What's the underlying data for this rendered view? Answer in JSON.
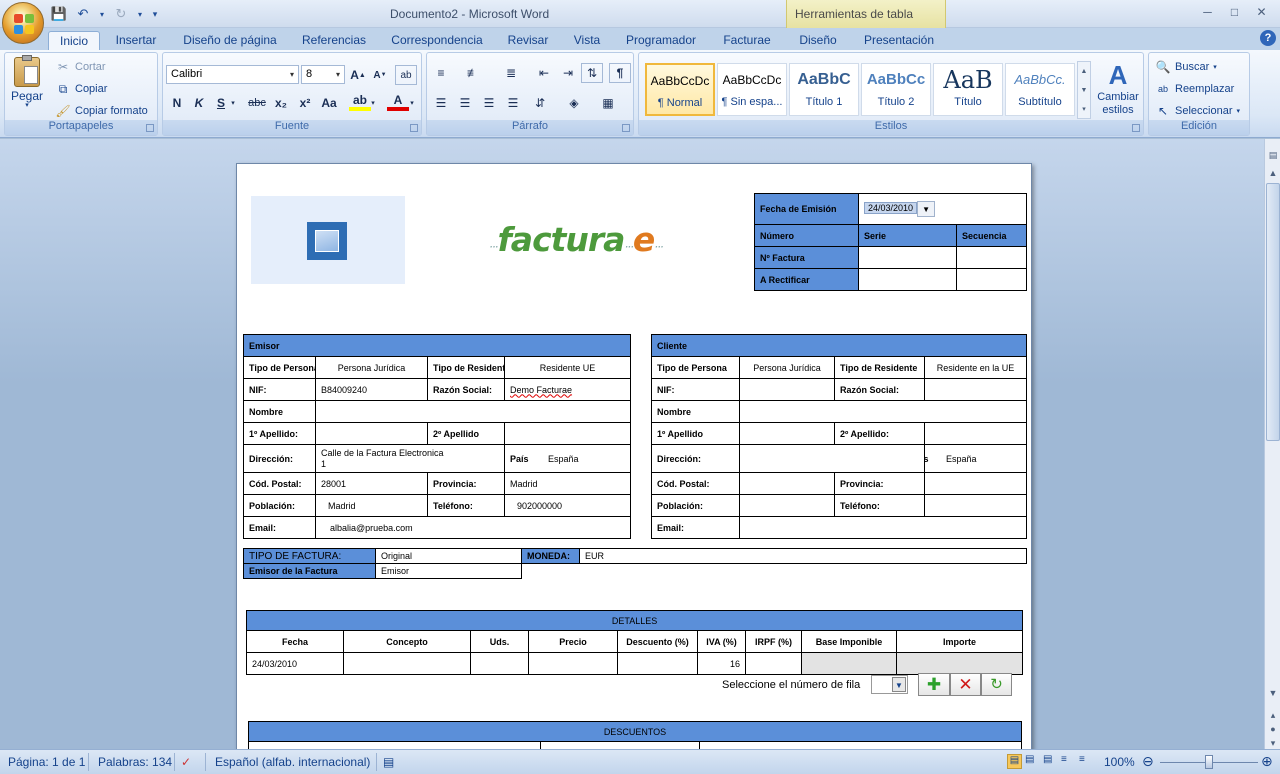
{
  "window": {
    "title": "Documento2 - Microsoft Word",
    "context_tab": "Herramientas de tabla"
  },
  "tabs": [
    "Inicio",
    "Insertar",
    "Diseño de página",
    "Referencias",
    "Correspondencia",
    "Revisar",
    "Vista",
    "Programador",
    "Facturae",
    "Diseño",
    "Presentación"
  ],
  "ribbon": {
    "clipboard": {
      "paste": "Pegar",
      "cut": "Cortar",
      "copy": "Copiar",
      "format_painter": "Copiar formato",
      "label": "Portapapeles"
    },
    "font": {
      "name": "Calibri",
      "size": "8",
      "label": "Fuente",
      "bold": "N",
      "italic": "K",
      "underline": "S",
      "strike": "abc",
      "sub": "x₂",
      "sup": "x²",
      "case": "Aa"
    },
    "paragraph": {
      "label": "Párrafo"
    },
    "styles": {
      "label": "Estilos",
      "change": "Cambiar estilos",
      "items": [
        {
          "sample": "AaBbCcDc",
          "name": "¶ Normal"
        },
        {
          "sample": "AaBbCcDc",
          "name": "¶ Sin espa..."
        },
        {
          "sample": "AaBbC",
          "name": "Título 1"
        },
        {
          "sample": "AaBbCc",
          "name": "Título 2"
        },
        {
          "sample": "AaB",
          "name": "Título"
        },
        {
          "sample": "AaBbCc.",
          "name": "Subtítulo"
        }
      ]
    },
    "editing": {
      "label": "Edición",
      "find": "Buscar",
      "replace": "Reemplazar",
      "select": "Seleccionar"
    }
  },
  "doc": {
    "brand": {
      "main": "factura",
      "e": "e"
    },
    "header_table": {
      "date_label": "Fecha de Emisión",
      "date_value": "24/03/2010",
      "numero": "Número",
      "serie": "Serie",
      "secuencia": "Secuencia",
      "n_factura": "Nº Factura",
      "a_rectificar": "A Rectificar"
    },
    "emisor": {
      "title": "Emisor",
      "tipo_persona_label": "Tipo de Persona",
      "tipo_persona": "Persona Jurídica",
      "tipo_residente_label": "Tipo de Residente",
      "tipo_residente": "Residente UE",
      "nif_label": "NIF:",
      "nif": "B84009240",
      "razon_label": "Razón Social:",
      "razon": "Demo Facturae",
      "nombre_label": "Nombre",
      "ap1_label": "1º  Apellido:",
      "ap2_label": "2º  Apellido",
      "direccion_label": "Dirección:",
      "direccion_1": "Calle de la Factura Electronica",
      "direccion_2": "1",
      "pais_label": "País",
      "pais": "España",
      "cp_label": "Cód. Postal:",
      "cp": "28001",
      "provincia_label": "Provincia:",
      "provincia": "Madrid",
      "poblacion_label": "Población:",
      "poblacion": "Madrid",
      "telefono_label": "Teléfono:",
      "telefono": "902000000",
      "email_label": "Email:",
      "email": "albalia@prueba.com"
    },
    "cliente": {
      "title": "Cliente",
      "tipo_persona_label": "Tipo de Persona",
      "tipo_persona": "Persona Jurídica",
      "tipo_residente_label": "Tipo de Residente",
      "tipo_residente": "Residente en la UE",
      "nif_label": "NIF:",
      "razon_label": "Razón Social:",
      "nombre_label": "Nombre",
      "ap1_label": "1º Apellido",
      "ap2_label": "2º  Apellido:",
      "direccion_label": "Dirección:",
      "pais_label": "País",
      "pais": "España",
      "cp_label": "Cód. Postal:",
      "provincia_label": "Provincia:",
      "poblacion_label": "Población:",
      "telefono_label": "Teléfono:",
      "email_label": "Email:"
    },
    "tipo": {
      "label": "TIPO DE FACTURA:",
      "value": "Original",
      "emisor_label": "Emisor de la Factura",
      "emisor_value": "Emisor",
      "moneda_label": "MONEDA:",
      "moneda": "EUR"
    },
    "detalles": {
      "title": "DETALLES",
      "cols": [
        "Fecha",
        "Concepto",
        "Uds.",
        "Precio",
        "Descuento (%)",
        "IVA (%)",
        "IRPF (%)",
        "Base Imponible",
        "Importe"
      ],
      "row": {
        "fecha": "24/03/2010",
        "iva": "16"
      },
      "select_row": "Seleccione el número de fila"
    },
    "descuentos": {
      "title": "DESCUENTOS"
    }
  },
  "status": {
    "page": "Página: 1 de 1",
    "words": "Palabras: 134",
    "lang": "Español (alfab. internacional)",
    "zoom": "100%"
  }
}
